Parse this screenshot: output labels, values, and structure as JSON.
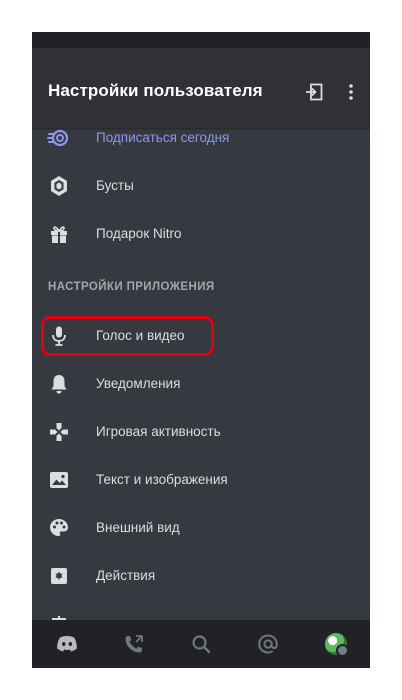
{
  "header": {
    "title": "Настройки пользователя"
  },
  "menu": {
    "nitro_items": [
      {
        "label": "Подписаться сегодня",
        "icon": "nitro-icon"
      },
      {
        "label": "Бусты",
        "icon": "boost-icon"
      },
      {
        "label": "Подарок Nitro",
        "icon": "gift-icon"
      }
    ],
    "app_section_title": "НАСТРОЙКИ ПРИЛОЖЕНИЯ",
    "app_items": [
      {
        "label": "Голос и видео",
        "icon": "microphone-icon"
      },
      {
        "label": "Уведомления",
        "icon": "bell-icon"
      },
      {
        "label": "Игровая активность",
        "icon": "gamepad-icon"
      },
      {
        "label": "Текст и изображения",
        "icon": "image-icon"
      },
      {
        "label": "Внешний вид",
        "icon": "palette-icon"
      },
      {
        "label": "Действия",
        "icon": "accessibility-icon"
      }
    ]
  },
  "bottom_nav": [
    "discord-home-icon",
    "friends-icon",
    "search-icon",
    "mentions-icon",
    "profile-avatar"
  ],
  "colors": {
    "background": "#36393f",
    "header": "#2f3136",
    "nav": "#202225",
    "nitro_accent": "#8e98e8",
    "highlight": "#e3000f",
    "text": "#dcddde"
  }
}
